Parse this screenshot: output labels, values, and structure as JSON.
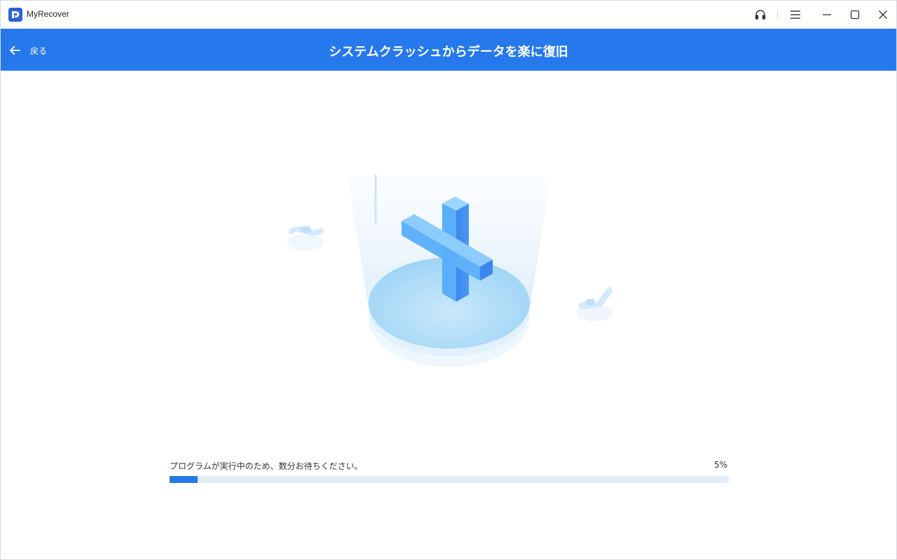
{
  "app": {
    "name": "MyRecover"
  },
  "titlebar": {
    "icons": [
      "headset-icon",
      "menu-icon",
      "minimize-icon",
      "maximize-icon",
      "close-icon"
    ]
  },
  "header": {
    "back_label": "戻る",
    "title": "システムクラッシュからデータを楽に復旧",
    "background_color": "#2579ec"
  },
  "illustration": {
    "icon": "medical-cross-repair-icon"
  },
  "progress": {
    "label": "プログラムが実行中のため、数分お待ちください。",
    "percent_text": "5%",
    "value": 5,
    "fill_color": "#2579ec"
  }
}
